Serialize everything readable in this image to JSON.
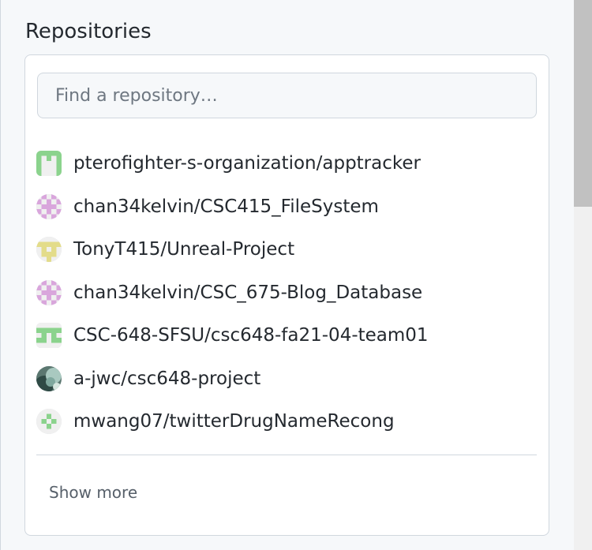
{
  "section": {
    "title": "Repositories"
  },
  "search": {
    "placeholder": "Find a repository…",
    "value": ""
  },
  "repositories": [
    {
      "name": "pterofighter-s-organization/apptracker",
      "avatar": "identicon-green-square"
    },
    {
      "name": "chan34kelvin/CSC415_FileSystem",
      "avatar": "identicon-pink"
    },
    {
      "name": "TonyT415/Unreal-Project",
      "avatar": "identicon-yellow"
    },
    {
      "name": "chan34kelvin/CSC_675-Blog_Database",
      "avatar": "identicon-pink"
    },
    {
      "name": "CSC-648-SFSU/csc648-fa21-04-team01",
      "avatar": "identicon-green-pi-square"
    },
    {
      "name": "a-jwc/csc648-project",
      "avatar": "photo-avatar"
    },
    {
      "name": "mwang07/twitterDrugNameRecong",
      "avatar": "identicon-green-dots"
    }
  ],
  "footer": {
    "show_more_label": "Show more"
  },
  "colors": {
    "text": "#24292f",
    "muted": "#57606a",
    "border": "#d0d7de",
    "background": "#f6f8fa",
    "identicon_green": "#8bd38d",
    "identicon_pink": "#d9a6dc",
    "identicon_yellow": "#e3dc8a"
  }
}
